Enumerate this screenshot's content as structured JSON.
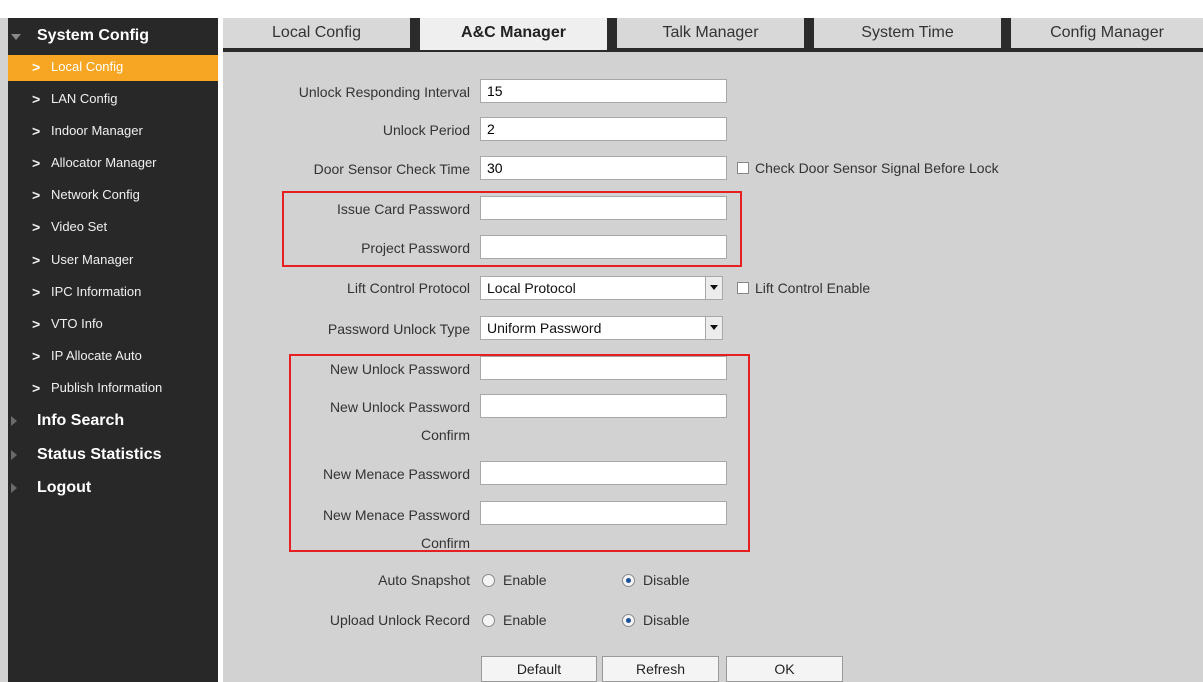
{
  "sidebar": {
    "groups": [
      {
        "label": "System Config",
        "expanded": true
      },
      {
        "label": "Info Search"
      },
      {
        "label": "Status Statistics"
      },
      {
        "label": "Logout"
      }
    ],
    "items": [
      {
        "label": "Local Config",
        "active": true
      },
      {
        "label": "LAN Config"
      },
      {
        "label": "Indoor Manager"
      },
      {
        "label": "Allocator Manager"
      },
      {
        "label": "Network Config"
      },
      {
        "label": "Video Set"
      },
      {
        "label": "User Manager"
      },
      {
        "label": "IPC Information"
      },
      {
        "label": "VTO Info"
      },
      {
        "label": "IP Allocate Auto"
      },
      {
        "label": "Publish Information"
      }
    ],
    "chevron": ">"
  },
  "tabs": [
    {
      "label": "Local Config"
    },
    {
      "label": "A&C Manager",
      "active": true
    },
    {
      "label": "Talk Manager"
    },
    {
      "label": "System Time"
    },
    {
      "label": "Config Manager"
    }
  ],
  "form": {
    "unlock_interval": {
      "label": "Unlock Responding Interval",
      "value": "15"
    },
    "unlock_period": {
      "label": "Unlock Period",
      "value": "2"
    },
    "door_sensor": {
      "label": "Door Sensor Check Time",
      "value": "30",
      "checkbox_label": "Check Door Sensor Signal Before Lock"
    },
    "issue_card_password": {
      "label": "Issue Card Password",
      "value": ""
    },
    "project_password": {
      "label": "Project Password",
      "value": ""
    },
    "lift_protocol": {
      "label": "Lift Control Protocol",
      "selected": "Local Protocol",
      "checkbox_label": "Lift Control Enable"
    },
    "password_unlock_type": {
      "label": "Password Unlock Type",
      "selected": "Uniform Password"
    },
    "new_unlock_password": {
      "label": "New Unlock Password",
      "value": ""
    },
    "new_unlock_password_confirm": {
      "label_line1": "New Unlock Password",
      "label_line2": "Confirm",
      "value": ""
    },
    "new_menace_password": {
      "label": "New Menace Password",
      "value": ""
    },
    "new_menace_password_confirm": {
      "label_line1": "New Menace Password",
      "label_line2": "Confirm",
      "value": ""
    },
    "auto_snapshot": {
      "label": "Auto Snapshot",
      "enable": "Enable",
      "disable": "Disable",
      "selected": "Disable"
    },
    "upload_unlock_record": {
      "label": "Upload Unlock Record",
      "enable": "Enable",
      "disable": "Disable",
      "selected": "Disable"
    }
  },
  "buttons": {
    "default": "Default",
    "refresh": "Refresh",
    "ok": "OK"
  },
  "colors": {
    "sidebar_bg": "#282828",
    "active_item": "#f6a623",
    "content_bg": "#d2d2d2",
    "highlight_box": "#e62020",
    "radio_dot": "#1a4f9c"
  }
}
